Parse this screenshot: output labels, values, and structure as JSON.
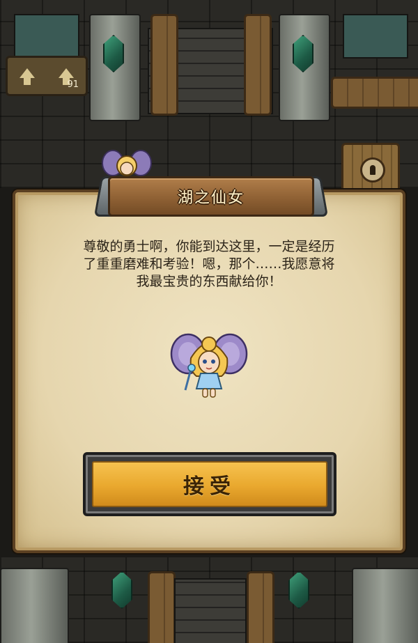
{
  "hud": {
    "floor_number": "91"
  },
  "dialog": {
    "title": "湖之仙女",
    "message_lines": [
      "尊敬的勇士啊，你能到达这里，一定是经历",
      "了重重磨难和考验！嗯，那个……我愿意将",
      "我最宝贵的东西献给你！"
    ],
    "accept_label": "接受"
  },
  "icons": {
    "stairs": "stairs-up-icon",
    "keyhole": "keyhole-door-icon",
    "fairy": "fairy-icon"
  },
  "colors": {
    "button_gold": "#e9a82e",
    "parchment": "#e6d6ae",
    "wood": "#8f6134"
  }
}
